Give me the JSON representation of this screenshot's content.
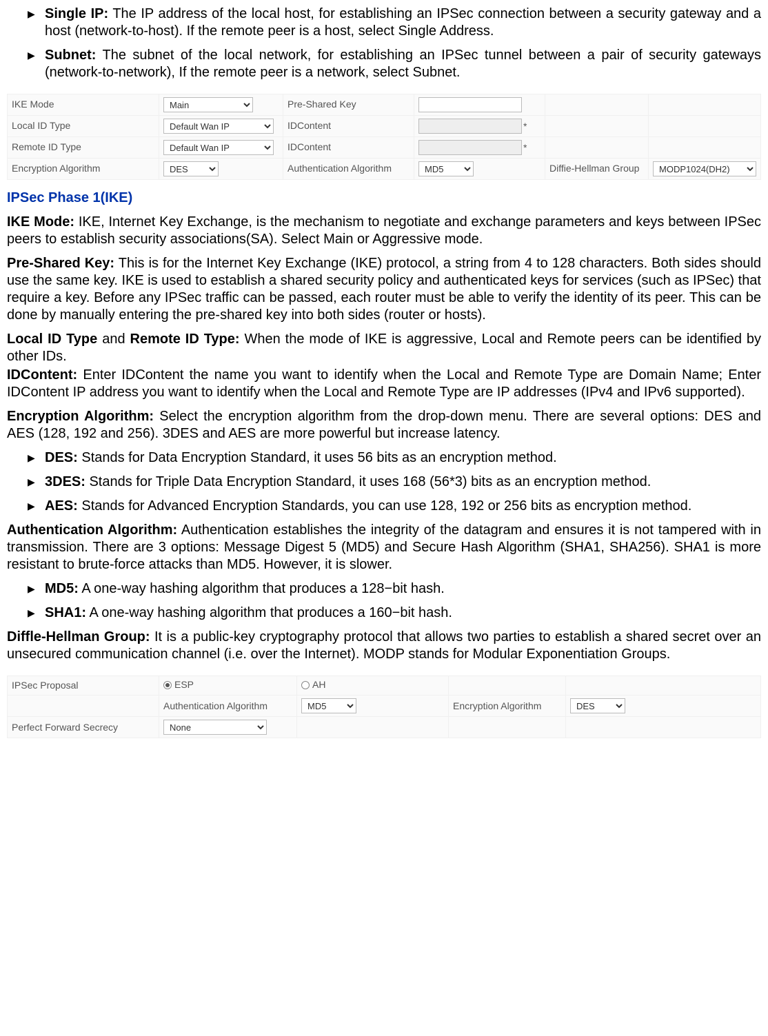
{
  "bullets_top": [
    {
      "term": "Single IP:",
      "text": " The IP address of the local host, for establishing an IPSec connection between a security gateway and a host (network-to-host). If the remote peer is a host, select Single Address."
    },
    {
      "term": "Subnet:",
      "text": " The subnet of the local network, for establishing an IPSec tunnel between a pair of security gateways (network-to-network), If the remote peer is a network, select Subnet."
    }
  ],
  "form1": {
    "rows": [
      {
        "l1": "IKE Mode",
        "s1": "Main",
        "l2": "Pre-Shared Key",
        "input2": "",
        "l3": "",
        "s3": ""
      },
      {
        "l1": "Local ID Type",
        "s1": "Default Wan IP",
        "l2": "IDContent",
        "input2": "",
        "star": "*",
        "l3": "",
        "s3": ""
      },
      {
        "l1": "Remote ID Type",
        "s1": "Default Wan IP",
        "l2": "IDContent",
        "input2": "",
        "star": "*",
        "l3": "",
        "s3": ""
      },
      {
        "l1": "Encryption Algorithm",
        "s1": "DES",
        "l2": "Authentication Algorithm",
        "s2": "MD5",
        "l3": "Diffie-Hellman Group",
        "s3": "MODP1024(DH2)"
      }
    ]
  },
  "section_title": "IPSec Phase 1(IKE)",
  "paras": {
    "ike_mode_term": "IKE Mode:",
    "ike_mode_text": " IKE, Internet Key Exchange, is the mechanism to negotiate and exchange parameters and keys between IPSec peers to establish security associations(SA). Select Main or Aggressive mode.",
    "psk_term": "Pre-Shared Key:",
    "psk_text": " This is for the Internet Key Exchange (IKE) protocol, a string from 4 to 128 characters. Both sides should use the same key. IKE is used to establish a shared security policy and authenticated keys for services (such as IPSec) that require a key. Before any IPSec traffic can be passed, each router must be able to verify the identity of its peer. This can be done by manually entering the pre-shared key into both sides (router or hosts).",
    "idtype_term1": "Local ID Type",
    "idtype_mid": " and ",
    "idtype_term2": "Remote ID Type:",
    "idtype_text": " When the mode of IKE is aggressive, Local and Remote peers can be identified by other IDs.",
    "idcontent_term": "IDContent:",
    "idcontent_text": " Enter IDContent the name you want to identify when the Local and Remote Type are Domain Name; Enter IDContent IP address you want to identify when the Local and Remote Type are IP addresses (IPv4 and IPv6 supported).",
    "enc_term": "Encryption Algorithm:",
    "enc_text": " Select the encryption algorithm from the drop-down menu. There are several options: DES and AES (128, 192 and 256). 3DES and AES are more powerful but increase latency."
  },
  "enc_bullets": [
    {
      "term": "DES:",
      "text": " Stands for Data Encryption Standard, it uses 56 bits as an encryption method."
    },
    {
      "term": "3DES:",
      "text": " Stands for Triple Data Encryption Standard, it uses 168 (56*3) bits as an encryption method."
    },
    {
      "term": "AES:",
      "text": " Stands for Advanced Encryption Standards, you can use 128, 192 or 256 bits as encryption method."
    }
  ],
  "auth_term": "Authentication Algorithm:",
  "auth_text": " Authentication establishes the integrity of the datagram and ensures it is not tampered with in transmission. There are 3 options: Message Digest 5 (MD5) and Secure Hash Algorithm (SHA1, SHA256). SHA1 is more resistant to brute-force attacks than MD5. However, it is slower.",
  "auth_bullets": [
    {
      "term": "MD5:",
      "text": " A one-way hashing algorithm that produces a 128−bit hash."
    },
    {
      "term": "SHA1:",
      "text": " A one-way hashing algorithm that produces a 160−bit hash."
    }
  ],
  "dh_term": "Diffle-Hellman Group:",
  "dh_text": " It is a public-key cryptography protocol that allows two parties to establish a shared secret over an unsecured communication channel (i.e. over the Internet). MODP stands for Modular Exponentiation Groups.",
  "form2": {
    "rows": [
      {
        "l1": "IPSec Proposal",
        "radio1": "ESP",
        "radio1checked": true,
        "radio2": "AH",
        "radio2checked": false
      },
      {
        "l1": "",
        "l2": "Authentication Algorithm",
        "s2": "MD5",
        "l3": "Encryption Algorithm",
        "s3": "DES"
      },
      {
        "l1": "Perfect Forward Secrecy",
        "s1": "None"
      }
    ]
  }
}
